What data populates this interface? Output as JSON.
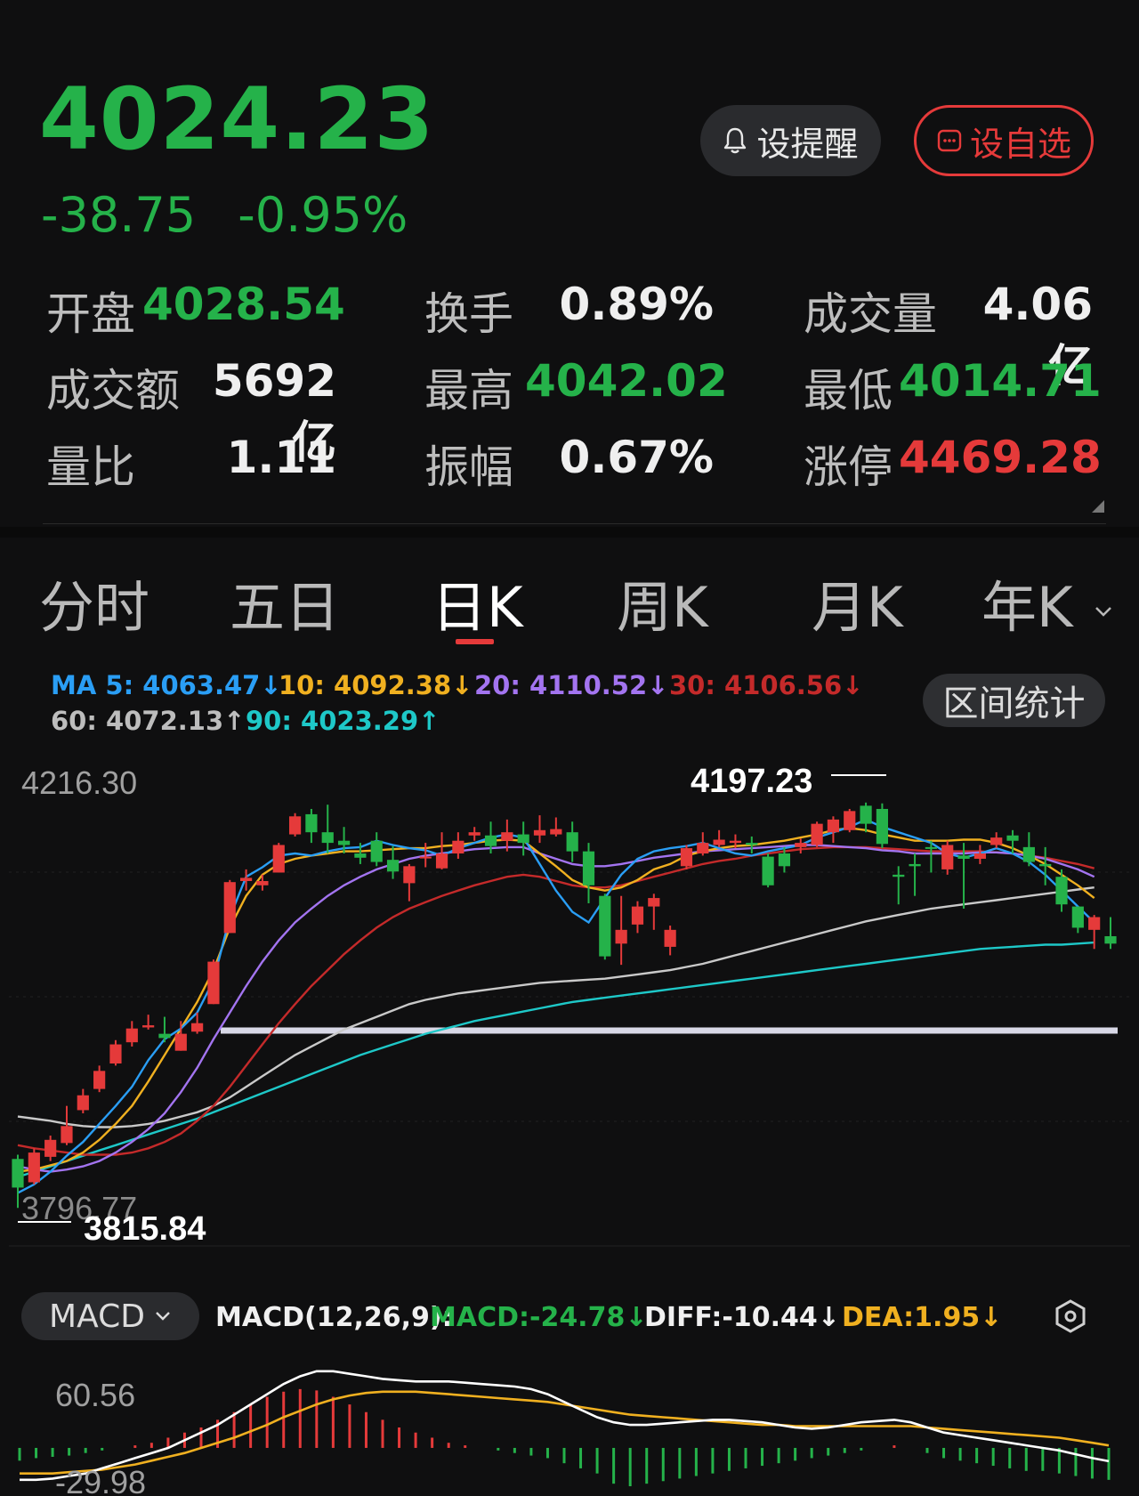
{
  "quote": {
    "price": "4024.23",
    "change": "-38.75",
    "change_pct": "-0.95%"
  },
  "buttons": {
    "alert": "设提醒",
    "watchlist": "设自选"
  },
  "stats": {
    "open_label": "开盘",
    "open_value": "4028.54",
    "turnover_label": "换手",
    "turnover_value": "0.89%",
    "volume_label": "成交量",
    "volume_value": "4.06亿",
    "amount_label": "成交额",
    "amount_value": "5692亿",
    "high_label": "最高",
    "high_value": "4042.02",
    "low_label": "最低",
    "low_value": "4014.71",
    "ratio_label": "量比",
    "ratio_value": "1.11",
    "amplitude_label": "振幅",
    "amplitude_value": "0.67%",
    "limit_up_label": "涨停",
    "limit_up_value": "4469.28"
  },
  "tabs": [
    "分时",
    "五日",
    "日K",
    "周K",
    "月K",
    "年K"
  ],
  "active_tab": "日K",
  "ma_legend": {
    "ma5": "MA 5: 4063.47↓",
    "ma10": "10: 4092.38↓",
    "ma20": "20: 4110.52↓",
    "ma30": "30: 4106.56↓",
    "ma60": "60: 4072.13↑",
    "ma90": "90: 4023.29↑"
  },
  "range_stat_button": "区间统计",
  "kline": {
    "axis_top": "4216.30",
    "axis_bottom": "3796.77",
    "high_marker": "4197.23",
    "low_marker": "3815.84"
  },
  "macd_bar": {
    "selector": "MACD",
    "params": "MACD(12,26,9):",
    "macd": "MACD:-24.78↓",
    "diff": "DIFF:-10.44↓",
    "dea": "DEA:1.95↓"
  },
  "macd_axis": {
    "top": "60.56",
    "bottom": "-29.98"
  },
  "colors": {
    "up": "#e53a3a",
    "down": "#25b24a",
    "ma5": "#2a9ef5",
    "ma10": "#f0b020",
    "ma20": "#a374f0",
    "ma30": "#c42a2a",
    "ma60": "#c9c9c9",
    "ma90": "#1ec8c8"
  },
  "chart_data": {
    "type": "candlestick",
    "y_axis": {
      "top_label": "4216.30",
      "bottom_label": "3796.77"
    },
    "marked_high": 4197.23,
    "marked_low": 3815.84,
    "candles": [
      {
        "o": 3862,
        "c": 3835,
        "h": 3866,
        "l": 3815.84
      },
      {
        "o": 3840,
        "c": 3868,
        "h": 3872,
        "l": 3838
      },
      {
        "o": 3864,
        "c": 3880,
        "h": 3884,
        "l": 3860
      },
      {
        "o": 3877,
        "c": 3893,
        "h": 3912,
        "l": 3875
      },
      {
        "o": 3908,
        "c": 3922,
        "h": 3928,
        "l": 3905
      },
      {
        "o": 3928,
        "c": 3945,
        "h": 3950,
        "l": 3925
      },
      {
        "o": 3952,
        "c": 3970,
        "h": 3974,
        "l": 3950
      },
      {
        "o": 3972,
        "c": 3985,
        "h": 3992,
        "l": 3968
      },
      {
        "o": 3986,
        "c": 3988,
        "h": 3998,
        "l": 3984
      },
      {
        "o": 3980,
        "c": 3976,
        "h": 3996,
        "l": 3972
      },
      {
        "o": 3964,
        "c": 3980,
        "h": 3992,
        "l": 3964
      },
      {
        "o": 3982,
        "c": 3990,
        "h": 4000,
        "l": 3980
      },
      {
        "o": 4008,
        "c": 4048,
        "h": 4050,
        "l": 4008
      },
      {
        "o": 4075,
        "c": 4123,
        "h": 4125,
        "l": 4075
      },
      {
        "o": 4124,
        "c": 4127,
        "h": 4135,
        "l": 4115
      },
      {
        "o": 4120,
        "c": 4124,
        "h": 4130,
        "l": 4115
      },
      {
        "o": 4132,
        "c": 4158,
        "h": 4160,
        "l": 4132
      },
      {
        "o": 4168,
        "c": 4185,
        "h": 4188,
        "l": 4166
      },
      {
        "o": 4187,
        "c": 4170,
        "h": 4192,
        "l": 4160
      },
      {
        "o": 4170,
        "c": 4160,
        "h": 4196,
        "l": 4150
      },
      {
        "o": 4162,
        "c": 4158,
        "h": 4175,
        "l": 4150
      },
      {
        "o": 4150,
        "c": 4146,
        "h": 4160,
        "l": 4140
      },
      {
        "o": 4162,
        "c": 4142,
        "h": 4170,
        "l": 4138
      },
      {
        "o": 4144,
        "c": 4133,
        "h": 4157,
        "l": 4126
      },
      {
        "o": 4122,
        "c": 4138,
        "h": 4140,
        "l": 4105
      },
      {
        "o": 4146,
        "c": 4147,
        "h": 4160,
        "l": 4137
      },
      {
        "o": 4136,
        "c": 4150,
        "h": 4170,
        "l": 4135
      },
      {
        "o": 4150,
        "c": 4162,
        "h": 4170,
        "l": 4145
      },
      {
        "o": 4167,
        "c": 4170,
        "h": 4175,
        "l": 4162
      },
      {
        "o": 4167,
        "c": 4157,
        "h": 4180,
        "l": 4150
      },
      {
        "o": 4162,
        "c": 4170,
        "h": 4182,
        "l": 4152
      },
      {
        "o": 4168,
        "c": 4160,
        "h": 4180,
        "l": 4148
      },
      {
        "o": 4167,
        "c": 4172,
        "h": 4186,
        "l": 4160
      },
      {
        "o": 4168,
        "c": 4173,
        "h": 4184,
        "l": 4166
      },
      {
        "o": 4170,
        "c": 4152,
        "h": 4180,
        "l": 4142
      },
      {
        "o": 4152,
        "c": 4120,
        "h": 4160,
        "l": 4103
      },
      {
        "o": 4110,
        "c": 4053,
        "h": 4112,
        "l": 4050
      },
      {
        "o": 4065,
        "c": 4078,
        "h": 4110,
        "l": 4045
      },
      {
        "o": 4083,
        "c": 4100,
        "h": 4105,
        "l": 4075
      },
      {
        "o": 4100,
        "c": 4108,
        "h": 4112,
        "l": 4078
      },
      {
        "o": 4062,
        "c": 4078,
        "h": 4082,
        "l": 4054
      },
      {
        "o": 4138,
        "c": 4155,
        "h": 4158,
        "l": 4135
      },
      {
        "o": 4150,
        "c": 4160,
        "h": 4170,
        "l": 4148
      },
      {
        "o": 4158,
        "c": 4163,
        "h": 4172,
        "l": 4156
      },
      {
        "o": 4160,
        "c": 4162,
        "h": 4168,
        "l": 4155
      },
      {
        "o": 4160,
        "c": 4158,
        "h": 4166,
        "l": 4150
      },
      {
        "o": 4147,
        "c": 4120,
        "h": 4150,
        "l": 4118
      },
      {
        "o": 4150,
        "c": 4138,
        "h": 4156,
        "l": 4132
      },
      {
        "o": 4156,
        "c": 4160,
        "h": 4164,
        "l": 4150
      },
      {
        "o": 4158,
        "c": 4178,
        "h": 4180,
        "l": 4156
      },
      {
        "o": 4170,
        "c": 4182,
        "h": 4185,
        "l": 4160
      },
      {
        "o": 4172,
        "c": 4190,
        "h": 4192,
        "l": 4170
      },
      {
        "o": 4195,
        "c": 4178,
        "h": 4198,
        "l": 4170
      },
      {
        "o": 4192,
        "c": 4159,
        "h": 4197.23,
        "l": 4155
      },
      {
        "o": 4130,
        "c": 4128,
        "h": 4138,
        "l": 4102
      },
      {
        "o": 4140,
        "c": 4138,
        "h": 4150,
        "l": 4110
      },
      {
        "o": 4156,
        "c": 4155,
        "h": 4162,
        "l": 4132
      },
      {
        "o": 4135,
        "c": 4158,
        "h": 4162,
        "l": 4130
      },
      {
        "o": 4148,
        "c": 4145,
        "h": 4160,
        "l": 4098
      },
      {
        "o": 4145,
        "c": 4150,
        "h": 4158,
        "l": 4140
      },
      {
        "o": 4158,
        "c": 4165,
        "h": 4170,
        "l": 4155
      },
      {
        "o": 4167,
        "c": 4162,
        "h": 4172,
        "l": 4150
      },
      {
        "o": 4156,
        "c": 4142,
        "h": 4170,
        "l": 4138
      },
      {
        "o": 4140,
        "c": 4138,
        "h": 4156,
        "l": 4120
      },
      {
        "o": 4128,
        "c": 4102,
        "h": 4135,
        "l": 4095
      },
      {
        "o": 4100,
        "c": 4080,
        "h": 4100,
        "l": 4075
      },
      {
        "o": 4078,
        "c": 4090,
        "h": 4092,
        "l": 4060
      },
      {
        "o": 4072,
        "c": 4065,
        "h": 4090,
        "l": 4060
      }
    ],
    "ma_series": {
      "ma5": [
        3830,
        3838,
        3850,
        3865,
        3878,
        3895,
        3912,
        3930,
        3955,
        3975,
        3985,
        4000,
        4030,
        4090,
        4128,
        4137,
        4148,
        4150,
        4148,
        4152,
        4155,
        4156,
        4162,
        4158,
        4155,
        4153,
        4148,
        4155,
        4160,
        4165,
        4168,
        4165,
        4140,
        4115,
        4095,
        4085,
        4108,
        4130,
        4145,
        4152,
        4155,
        4157,
        4160,
        4155,
        4150,
        4148,
        4152,
        4155,
        4158,
        4165,
        4170,
        4175,
        4182,
        4175,
        4170,
        4165,
        4160,
        4150,
        4146,
        4150,
        4155,
        4150,
        4142,
        4130,
        4115,
        4100,
        4085
      ],
      "ma10": [
        3850,
        3852,
        3856,
        3860,
        3868,
        3880,
        3895,
        3912,
        3935,
        3960,
        3985,
        4010,
        4040,
        4080,
        4110,
        4130,
        4140,
        4145,
        4148,
        4150,
        4152,
        4152,
        4153,
        4154,
        4155,
        4155,
        4157,
        4158,
        4160,
        4162,
        4163,
        4162,
        4150,
        4138,
        4125,
        4118,
        4115,
        4118,
        4125,
        4135,
        4140,
        4148,
        4152,
        4155,
        4157,
        4158,
        4160,
        4162,
        4165,
        4168,
        4172,
        4174,
        4172,
        4168,
        4165,
        4162,
        4162,
        4162,
        4163,
        4163,
        4160,
        4155,
        4148,
        4140,
        4130,
        4120,
        4108
      ],
      "ma20": [
        3855,
        3852,
        3850,
        3852,
        3855,
        3860,
        3868,
        3878,
        3890,
        3905,
        3925,
        3948,
        3975,
        4000,
        4025,
        4048,
        4068,
        4085,
        4098,
        4110,
        4120,
        4128,
        4135,
        4140,
        4145,
        4148,
        4150,
        4152,
        4154,
        4155,
        4156,
        4156,
        4150,
        4145,
        4140,
        4138,
        4138,
        4140,
        4143,
        4146,
        4148,
        4150,
        4152,
        4153,
        4154,
        4155,
        4156,
        4157,
        4158,
        4158,
        4157,
        4156,
        4155,
        4153,
        4152,
        4150,
        4150,
        4150,
        4150,
        4151,
        4151,
        4150,
        4148,
        4145,
        4140,
        4135,
        4128
      ],
      "ma30": [
        3875,
        3872,
        3870,
        3868,
        3866,
        3866,
        3866,
        3868,
        3872,
        3878,
        3886,
        3898,
        3912,
        3930,
        3950,
        3970,
        3990,
        4008,
        4025,
        4040,
        4055,
        4068,
        4080,
        4090,
        4098,
        4104,
        4110,
        4115,
        4120,
        4124,
        4128,
        4130,
        4128,
        4124,
        4120,
        4118,
        4118,
        4120,
        4124,
        4128,
        4132,
        4136,
        4140,
        4143,
        4145,
        4148,
        4150,
        4152,
        4154,
        4155,
        4156,
        4156,
        4156,
        4155,
        4154,
        4153,
        4152,
        4152,
        4152,
        4152,
        4151,
        4150,
        4148,
        4146,
        4143,
        4140,
        4136
      ],
      "ma60": [
        3902,
        3900,
        3898,
        3895,
        3893,
        3892,
        3892,
        3893,
        3895,
        3898,
        3902,
        3906,
        3912,
        3920,
        3930,
        3940,
        3950,
        3960,
        3968,
        3976,
        3984,
        3990,
        3996,
        4002,
        4008,
        4012,
        4015,
        4018,
        4020,
        4022,
        4024,
        4026,
        4028,
        4029,
        4030,
        4031,
        4032,
        4034,
        4036,
        4038,
        4040,
        4043,
        4046,
        4050,
        4054,
        4058,
        4062,
        4066,
        4070,
        4074,
        4078,
        4082,
        4086,
        4089,
        4092,
        4095,
        4098,
        4100,
        4102,
        4104,
        4106,
        4108,
        4110,
        4112,
        4114,
        4116,
        4118
      ],
      "ma90": [
        3845,
        3850,
        3855,
        3860,
        3865,
        3870,
        3875,
        3880,
        3885,
        3890,
        3895,
        3900,
        3906,
        3912,
        3918,
        3924,
        3930,
        3936,
        3942,
        3948,
        3954,
        3960,
        3965,
        3970,
        3975,
        3980,
        3984,
        3988,
        3992,
        3995,
        3998,
        4001,
        4004,
        4007,
        4010,
        4012,
        4014,
        4016,
        4018,
        4020,
        4022,
        4024,
        4026,
        4028,
        4030,
        4032,
        4034,
        4036,
        4038,
        4040,
        4042,
        4044,
        4046,
        4048,
        4050,
        4052,
        4054,
        4056,
        4058,
        4060,
        4061,
        4062,
        4063,
        4064,
        4064,
        4065,
        4066
      ]
    },
    "macd_panel": {
      "axis_top": 60.56,
      "axis_bottom": -29.98,
      "histogram": [
        -10,
        -8,
        -7,
        -6,
        -4,
        -2,
        0,
        2,
        4,
        8,
        12,
        16,
        22,
        28,
        34,
        40,
        44,
        46,
        45,
        40,
        34,
        28,
        22,
        16,
        12,
        8,
        4,
        2,
        0,
        -2,
        -4,
        -6,
        -8,
        -12,
        -16,
        -20,
        -28,
        -30,
        -28,
        -26,
        -24,
        -22,
        -20,
        -18,
        -16,
        -14,
        -12,
        -10,
        -8,
        -6,
        -4,
        -2,
        0,
        2,
        0,
        -4,
        -8,
        -10,
        -12,
        -14,
        -16,
        -18,
        -18,
        -20,
        -22,
        -24,
        -25
      ],
      "diff": [
        -25,
        -25,
        -24,
        -22,
        -20,
        -16,
        -12,
        -8,
        -4,
        0,
        6,
        12,
        18,
        26,
        34,
        42,
        50,
        56,
        60,
        60,
        58,
        56,
        54,
        53,
        52,
        52,
        52,
        51,
        50,
        49,
        48,
        46,
        42,
        36,
        30,
        24,
        20,
        18,
        18,
        19,
        20,
        21,
        22,
        22,
        21,
        20,
        18,
        16,
        15,
        16,
        18,
        20,
        21,
        22,
        20,
        16,
        12,
        10,
        8,
        6,
        4,
        2,
        0,
        -2,
        -5,
        -8,
        -10.44
      ],
      "dea": [
        -20,
        -20,
        -20,
        -19,
        -18,
        -17,
        -15,
        -13,
        -10,
        -7,
        -4,
        0,
        4,
        8,
        13,
        18,
        24,
        29,
        34,
        38,
        41,
        43,
        44,
        44,
        44,
        43,
        42,
        41,
        40,
        39,
        38,
        37,
        36,
        34,
        32,
        30,
        28,
        26,
        25,
        24,
        23,
        22,
        21,
        20,
        19,
        18,
        18,
        17,
        17,
        17,
        17,
        17,
        17,
        17,
        17,
        16,
        15,
        14,
        13,
        12,
        11,
        10,
        9,
        8,
        6,
        4,
        1.95
      ]
    }
  }
}
